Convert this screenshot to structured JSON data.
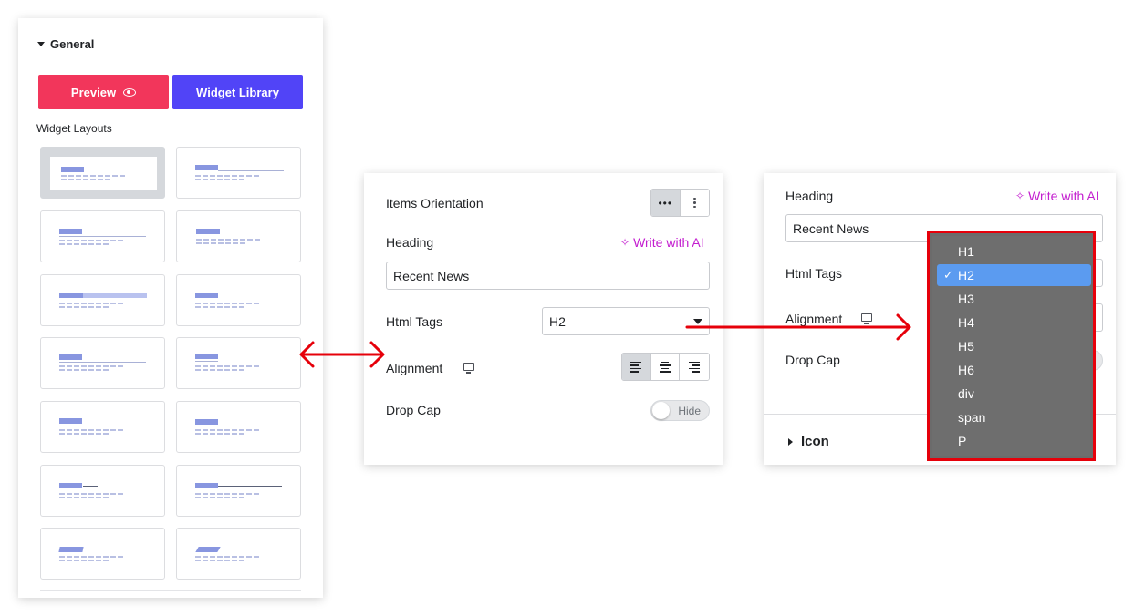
{
  "left_panel": {
    "section_title": "General",
    "preview_label": "Preview",
    "library_label": "Widget Library",
    "widget_layouts_label": "Widget Layouts"
  },
  "middle_panel": {
    "orientation_label": "Items Orientation",
    "heading_label": "Heading",
    "ai_label": "Write with AI",
    "heading_value": "Recent News",
    "html_tags_label": "Html Tags",
    "html_tags_value": "H2",
    "alignment_label": "Alignment",
    "drop_cap_label": "Drop Cap",
    "drop_cap_toggle": "Hide"
  },
  "right_panel": {
    "heading_label": "Heading",
    "ai_label": "Write with AI",
    "heading_value": "Recent News",
    "html_tags_label": "Html Tags",
    "alignment_label": "Alignment",
    "drop_cap_label": "Drop Cap",
    "icon_section": "Icon"
  },
  "dropdown": {
    "options": [
      "H1",
      "H2",
      "H3",
      "H4",
      "H5",
      "H6",
      "div",
      "span",
      "P"
    ],
    "selected": "H2",
    "check": "✓"
  },
  "colors": {
    "preview": "#f2365b",
    "library": "#5144f7",
    "ai": "#c31dcf",
    "annotation": "#e6000a"
  }
}
